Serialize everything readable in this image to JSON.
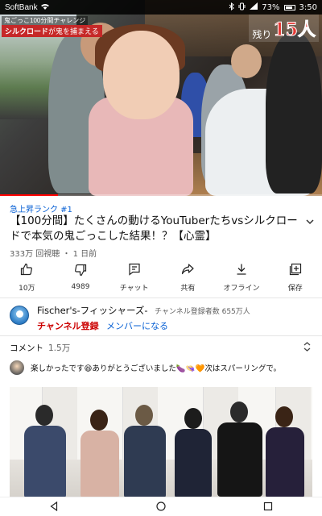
{
  "status_bar": {
    "carrier": "SoftBank",
    "battery": "73%",
    "time": "3:50"
  },
  "video": {
    "overlay_top": "鬼ごっこ100分間チャレンジ",
    "overlay_tag": "シルクロード",
    "overlay_tag_suffix": "が鬼を捕まえる",
    "remaining_label": "残り",
    "remaining_count": "15人",
    "progress_fraction": 0.18
  },
  "info": {
    "rank": "急上昇ランク #1",
    "title": "【100分間】たくさんの動けるYouTuberたちvsシルクロードで本気の鬼ごっこした結果！？【心霊】",
    "views": "333万 回視聴",
    "age": "1 日前"
  },
  "actions": [
    {
      "name": "like-button",
      "icon": "thumbs-up-icon",
      "label": "10万"
    },
    {
      "name": "dislike-button",
      "icon": "thumbs-down-icon",
      "label": "4989"
    },
    {
      "name": "chat-button",
      "icon": "chat-icon",
      "label": "チャット"
    },
    {
      "name": "share-button",
      "icon": "share-icon",
      "label": "共有"
    },
    {
      "name": "offline-button",
      "icon": "download-icon",
      "label": "オフライン"
    },
    {
      "name": "save-button",
      "icon": "add-playlist-icon",
      "label": "保存"
    }
  ],
  "channel": {
    "name": "Fischer's-フィッシャーズ-",
    "subscribers": "チャンネル登録者数 655万人",
    "subscribe_label": "チャンネル登録",
    "member_label": "メンバーになる"
  },
  "comments": {
    "heading": "コメント",
    "count": "1.5万",
    "top_comment": "楽しかったです😆ありがとうございました🍆👒🧡次はスパーリングで。"
  },
  "colors": {
    "accent": "#065fd4",
    "brand": "#cc0000"
  }
}
